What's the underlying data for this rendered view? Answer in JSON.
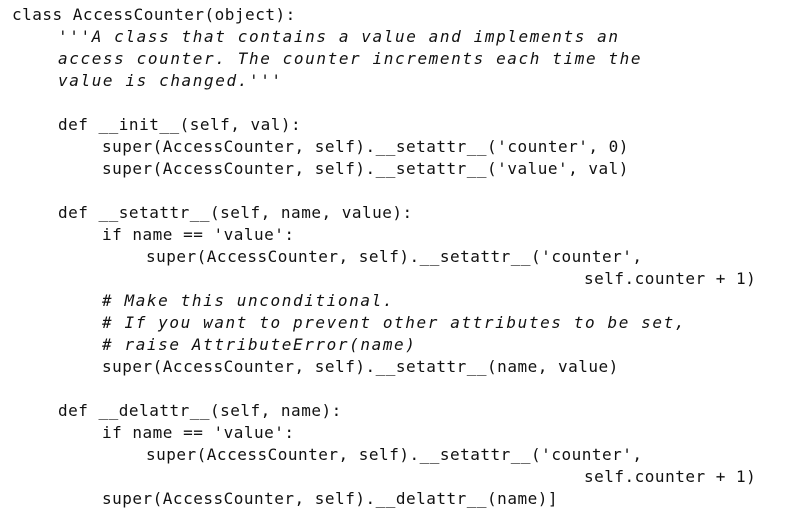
{
  "code": {
    "lines": [
      "class AccessCounter(object):",
      "    '''A class that contains a value and implements an",
      "    access counter. The counter increments each time the",
      "    value is changed.'''",
      "",
      "    def __init__(self, val):",
      "        super(AccessCounter, self).__setattr__('counter', 0)",
      "        super(AccessCounter, self).__setattr__('value', val)",
      "",
      "    def __setattr__(self, name, value):",
      "        if name == 'value':",
      "            super(AccessCounter, self).__setattr__('counter',",
      "                                          self.counter + 1)",
      "        # Make this unconditional.",
      "        # If you want to prevent other attributes to be set,",
      "        # raise AttributeError(name)",
      "        super(AccessCounter, self).__setattr__(name, value)",
      "",
      "    def __delattr__(self, name):",
      "        if name == 'value':",
      "            super(AccessCounter, self).__setattr__('counter',",
      "                                          self.counter + 1)",
      "        super(AccessCounter, self).__delattr__(name)]"
    ]
  }
}
